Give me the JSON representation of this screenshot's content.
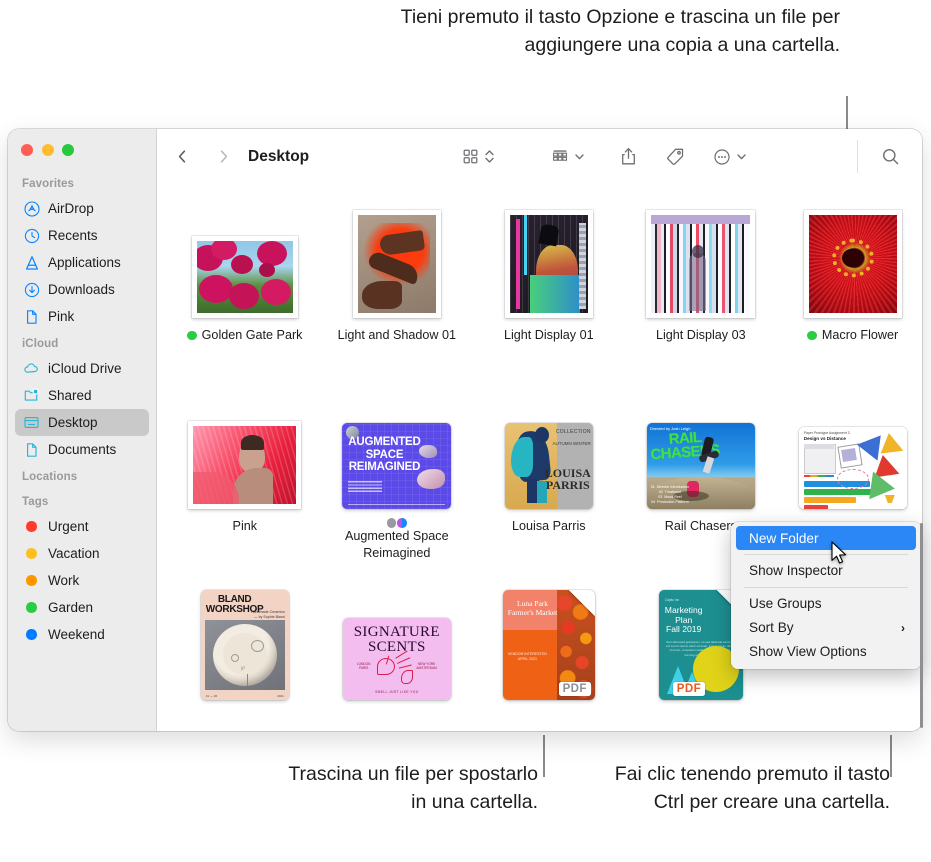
{
  "callouts": {
    "top": "Tieni premuto il tasto Opzione e trascina un file per aggiungere una copia a una cartella.",
    "bottom_left": "Trascina un file per spostarlo in una cartella.",
    "bottom_right": "Fai clic tenendo premuto il tasto Ctrl per creare una cartella."
  },
  "window": {
    "title": "Desktop"
  },
  "toolbar": {
    "back_icon": "chevron-left-icon",
    "forward_icon": "chevron-right-icon",
    "view_icon": "grid-view-icon",
    "group_icon": "group-by-icon",
    "share_icon": "share-icon",
    "tags_icon": "tag-icon",
    "more_icon": "more-actions-icon",
    "search_icon": "search-icon"
  },
  "sidebar": {
    "sections": [
      {
        "title": "Favorites",
        "items": [
          {
            "label": "AirDrop",
            "icon": "airdrop-icon",
            "active": false
          },
          {
            "label": "Recents",
            "icon": "clock-icon",
            "active": false
          },
          {
            "label": "Applications",
            "icon": "applications-icon",
            "active": false
          },
          {
            "label": "Downloads",
            "icon": "downloads-icon",
            "active": false
          },
          {
            "label": "Pink",
            "icon": "document-icon",
            "active": false
          }
        ]
      },
      {
        "title": "iCloud",
        "items": [
          {
            "label": "iCloud Drive",
            "icon": "cloud-icon",
            "active": false
          },
          {
            "label": "Shared",
            "icon": "shared-folder-icon",
            "active": false
          },
          {
            "label": "Desktop",
            "icon": "desktop-icon",
            "active": true
          },
          {
            "label": "Documents",
            "icon": "document-icon",
            "active": false
          }
        ]
      },
      {
        "title": "Locations",
        "items": []
      },
      {
        "title": "Tags",
        "items": [
          {
            "label": "Urgent",
            "icon": "tag-dot-icon",
            "color": "#ff3b30",
            "active": false
          },
          {
            "label": "Vacation",
            "icon": "tag-dot-icon",
            "color": "#ffc01e",
            "active": false
          },
          {
            "label": "Work",
            "icon": "tag-dot-icon",
            "color": "#ff9500",
            "active": false
          },
          {
            "label": "Garden",
            "icon": "tag-dot-icon",
            "color": "#28cd41",
            "active": false
          },
          {
            "label": "Weekend",
            "icon": "tag-dot-icon",
            "color": "#007aff",
            "active": false
          }
        ]
      }
    ]
  },
  "files": {
    "row1": [
      {
        "name": "Golden Gate Park",
        "dots": [
          "#28cd41"
        ]
      },
      {
        "name": "Light and Shadow 01",
        "dots": []
      },
      {
        "name": "Light Display 01",
        "dots": []
      },
      {
        "name": "Light Display 03",
        "dots": []
      },
      {
        "name": "Macro Flower",
        "dots": [
          "#28cd41"
        ]
      }
    ],
    "row2": [
      {
        "name": "Pink",
        "dots": []
      },
      {
        "name": "Augmented Space Reimagined",
        "dots": [
          "#9a9a9e",
          "half"
        ]
      },
      {
        "name": "Louisa Parris",
        "dots": []
      },
      {
        "name": "Rail Chasers",
        "dots": []
      },
      {
        "name": "",
        "dots": []
      }
    ],
    "row3": [
      {
        "name": "",
        "dots": []
      },
      {
        "name": "",
        "dots": []
      },
      {
        "name": "",
        "dots": [],
        "badge": "PDF"
      },
      {
        "name": "",
        "dots": [],
        "badge": "PDF"
      }
    ],
    "thumb_text": {
      "augmented_l1": "AUGMENTED",
      "augmented_l2": "SPACE",
      "augmented_l3": "REIMAGINED",
      "louisa_l1": "LOUISA",
      "louisa_l2": "PARRIS",
      "bland_l1": "BLAND",
      "bland_l2": "WORKSHOP",
      "signature_l1": "SIGNATURE",
      "signature_l2": "SCENTS",
      "rail_l1": "RAIL",
      "rail_l2": "CHASERS",
      "luna_l1": "Luna Park",
      "luna_l2": "Farmer's Market",
      "marketing_l1": "Marketing",
      "marketing_l2": "Plan",
      "marketing_l3": "Fall 2019"
    }
  },
  "context_menu": {
    "items": [
      {
        "label": "New Folder",
        "selected": true,
        "submenu": false
      },
      {
        "label": "Show Inspector",
        "selected": false,
        "submenu": false
      },
      {
        "label": "Use Groups",
        "selected": false,
        "submenu": false
      },
      {
        "label": "Sort By",
        "selected": false,
        "submenu": true,
        "arrow": "›"
      },
      {
        "label": "Show View Options",
        "selected": false,
        "submenu": false
      }
    ]
  },
  "colors": {
    "selection_blue": "#2b87f5",
    "sidebar_bg": "#ececec",
    "tag_green": "#28cd41"
  }
}
